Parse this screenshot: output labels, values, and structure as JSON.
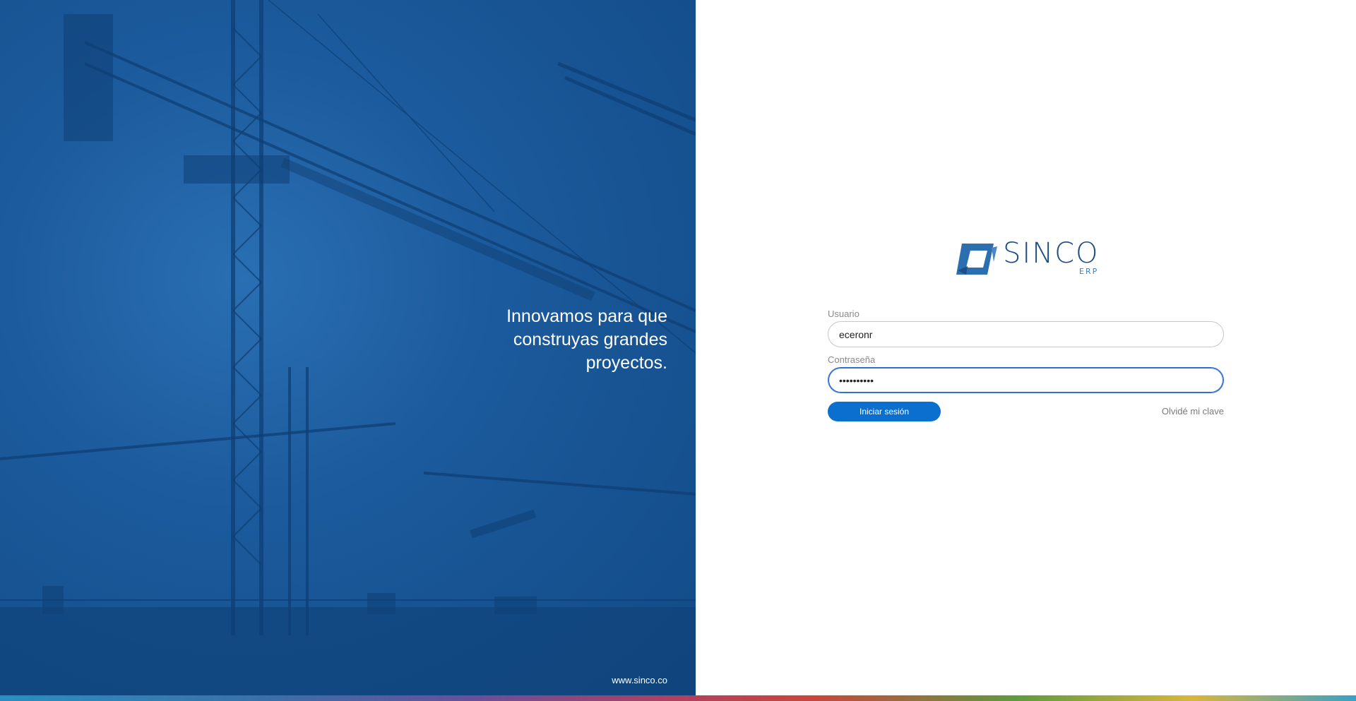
{
  "hero": {
    "tagline_lines": [
      "Innovamos para que",
      "construyas grandes",
      "proyectos."
    ],
    "site_link": "www.sinco.co"
  },
  "logo": {
    "word": "SINCO",
    "sub": "ERP",
    "brand_color": "#1d4f86",
    "icon": "sinco-logo-icon"
  },
  "form": {
    "user_label": "Usuario",
    "user_value": "eceronr",
    "password_label": "Contraseña",
    "password_value": "••••••••••",
    "submit_label": "Iniciar sesión",
    "forgot_label": "Olvidé mi clave"
  },
  "colors": {
    "primary": "#0a6fce",
    "hero_bg": "#1b5a9c",
    "focus": "#2f6fd0"
  }
}
